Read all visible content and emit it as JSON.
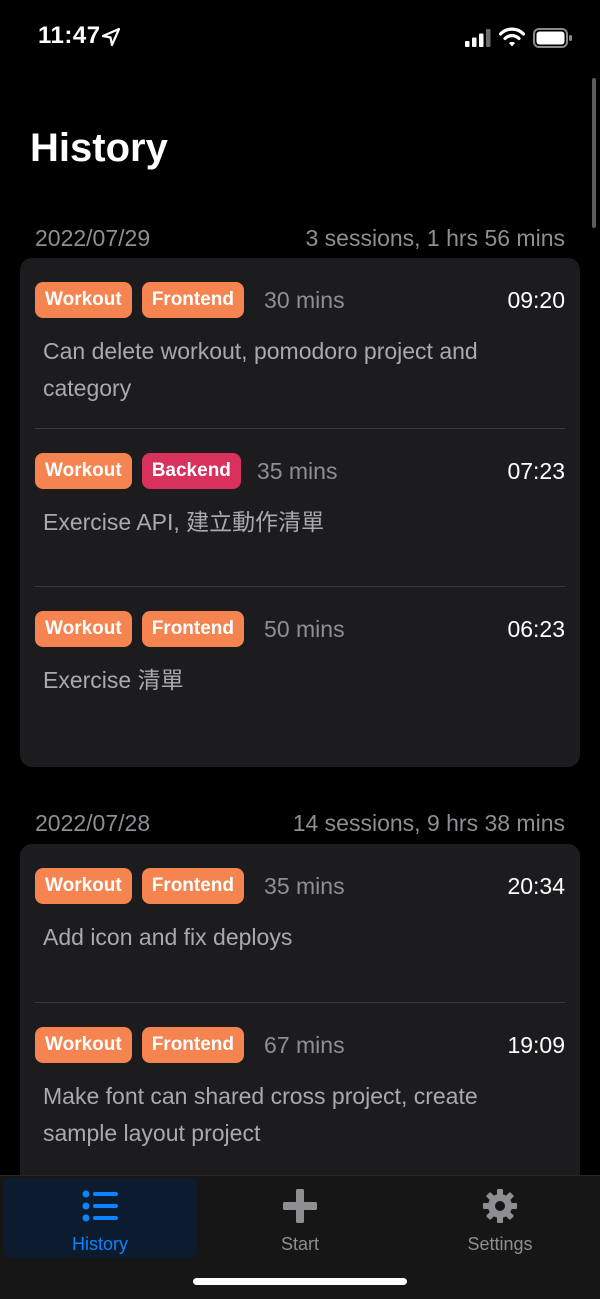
{
  "status": {
    "time": "11:47"
  },
  "page": {
    "title": "History"
  },
  "days": [
    {
      "date": "2022/07/29",
      "summary": "3 sessions, 1 hrs 56 mins",
      "sessions": [
        {
          "tags": [
            "Workout",
            "Frontend"
          ],
          "duration": "30 mins",
          "time": "09:20",
          "note": "Can delete workout, pomodoro project and category"
        },
        {
          "tags": [
            "Workout",
            "Backend"
          ],
          "duration": "35 mins",
          "time": "07:23",
          "note": "Exercise API, 建立動作清單"
        },
        {
          "tags": [
            "Workout",
            "Frontend"
          ],
          "duration": "50 mins",
          "time": "06:23",
          "note": "Exercise 清單"
        }
      ]
    },
    {
      "date": "2022/07/28",
      "summary": "14 sessions, 9 hrs 38 mins",
      "sessions": [
        {
          "tags": [
            "Workout",
            "Frontend"
          ],
          "duration": "35 mins",
          "time": "20:34",
          "note": "Add icon and fix deploys"
        },
        {
          "tags": [
            "Workout",
            "Frontend"
          ],
          "duration": "67 mins",
          "time": "19:09",
          "note": "Make font can shared cross project, create sample layout project"
        }
      ]
    }
  ],
  "tabs": [
    {
      "label": "History",
      "icon": "list-icon",
      "active": true
    },
    {
      "label": "Start",
      "icon": "plus-icon",
      "active": false
    },
    {
      "label": "Settings",
      "icon": "gear-icon",
      "active": false
    }
  ],
  "colors": {
    "accent": "#0a84ff",
    "tag_orange": "#f68450",
    "tag_pink": "#d7315c",
    "card": "#1c1c1e",
    "background": "#000000"
  }
}
